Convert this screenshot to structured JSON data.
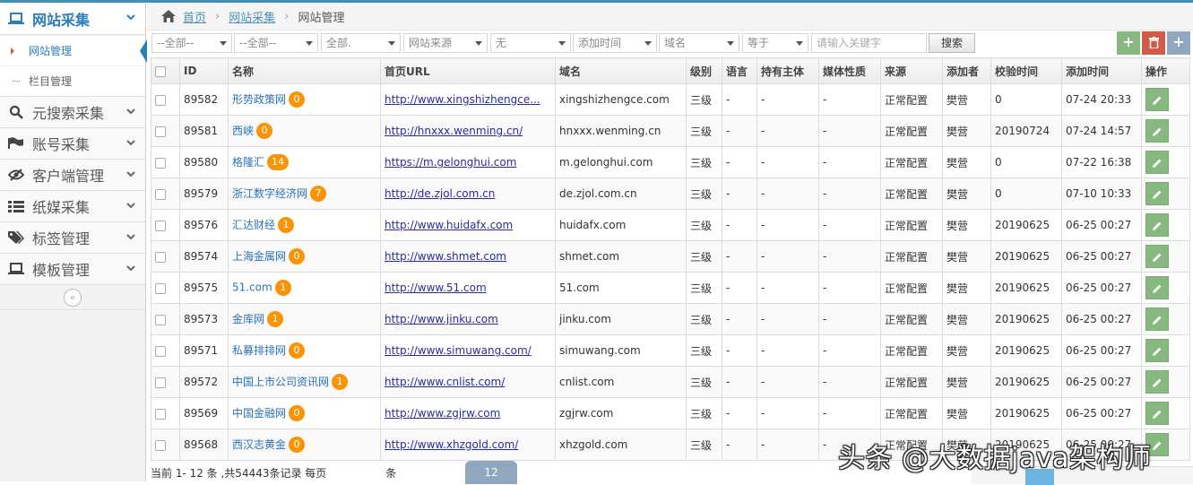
{
  "sidebar": {
    "main_item": "网站采集",
    "sub_items": [
      "网站管理",
      "栏目管理"
    ],
    "items": [
      {
        "label": "元搜索采集",
        "icon": "search-icon"
      },
      {
        "label": "账号采集",
        "icon": "flag-icon"
      },
      {
        "label": "客户端管理",
        "icon": "eye-slash-icon"
      },
      {
        "label": "纸媒采集",
        "icon": "list-icon"
      },
      {
        "label": "标签管理",
        "icon": "tags-icon"
      },
      {
        "label": "模板管理",
        "icon": "laptop-icon"
      }
    ],
    "collapse": "«"
  },
  "breadcrumb": {
    "home": "首页",
    "section": "网站采集",
    "current": "网站管理"
  },
  "filters": {
    "f1": "--全部--",
    "f2": "--全部--",
    "f3": "全部.",
    "f4": "网站来源",
    "f5": "无",
    "f6": "添加时间",
    "f7": "域名",
    "f8": "等于",
    "keyword_placeholder": "请输入关键字",
    "search": "搜索"
  },
  "actions": {
    "add": "+",
    "delete": "🗑",
    "more": "+"
  },
  "table": {
    "headers": [
      "ID",
      "名称",
      "首页URL",
      "域名",
      "级别",
      "语言",
      "持有主体",
      "媒体性质",
      "来源",
      "添加者",
      "校验时间",
      "添加时间",
      "操作"
    ],
    "rows": [
      {
        "id": "89582",
        "name": "形势政策网",
        "count": "0",
        "url": "http://www.xingshizhengce...",
        "domain": "xingshizhengce.com",
        "level": "三级",
        "lang": "-",
        "owner": "-",
        "media": "-",
        "source": "正常配置",
        "adder": "樊营",
        "check": "0",
        "added": "07-24 20:33"
      },
      {
        "id": "89581",
        "name": "西峡",
        "count": "0",
        "url": "http://hnxxx.wenming.cn/",
        "domain": "hnxxx.wenming.cn",
        "level": "三级",
        "lang": "-",
        "owner": "-",
        "media": "-",
        "source": "正常配置",
        "adder": "樊营",
        "check": "20190724",
        "added": "07-24 14:57"
      },
      {
        "id": "89580",
        "name": "格隆汇",
        "count": "14",
        "url": "https://m.gelonghui.com",
        "domain": "m.gelonghui.com",
        "level": "三级",
        "lang": "-",
        "owner": "-",
        "media": "-",
        "source": "正常配置",
        "adder": "樊营",
        "check": "0",
        "added": "07-22 16:38"
      },
      {
        "id": "89579",
        "name": "浙江数字经济网",
        "count": "7",
        "url": "http://de.zjol.com.cn",
        "domain": "de.zjol.com.cn",
        "level": "三级",
        "lang": "-",
        "owner": "-",
        "media": "-",
        "source": "正常配置",
        "adder": "樊营",
        "check": "0",
        "added": "07-10 10:33"
      },
      {
        "id": "89576",
        "name": "汇达财经",
        "count": "1",
        "url": "http://www.huidafx.com",
        "domain": "huidafx.com",
        "level": "三级",
        "lang": "-",
        "owner": "-",
        "media": "-",
        "source": "正常配置",
        "adder": "樊营",
        "check": "20190625",
        "added": "06-25 00:27"
      },
      {
        "id": "89574",
        "name": "上海金属网",
        "count": "0",
        "url": "http://www.shmet.com",
        "domain": "shmet.com",
        "level": "三级",
        "lang": "-",
        "owner": "-",
        "media": "-",
        "source": "正常配置",
        "adder": "樊营",
        "check": "20190625",
        "added": "06-25 00:27"
      },
      {
        "id": "89575",
        "name": "51.com",
        "count": "1",
        "url": "http://www.51.com",
        "domain": "51.com",
        "level": "三级",
        "lang": "-",
        "owner": "-",
        "media": "-",
        "source": "正常配置",
        "adder": "樊营",
        "check": "20190625",
        "added": "06-25 00:27"
      },
      {
        "id": "89573",
        "name": "金库网",
        "count": "1",
        "url": "http://www.jinku.com",
        "domain": "jinku.com",
        "level": "三级",
        "lang": "-",
        "owner": "-",
        "media": "-",
        "source": "正常配置",
        "adder": "樊营",
        "check": "20190625",
        "added": "06-25 00:27"
      },
      {
        "id": "89571",
        "name": "私募排排网",
        "count": "0",
        "url": "http://www.simuwang.com/",
        "domain": "simuwang.com",
        "level": "三级",
        "lang": "-",
        "owner": "-",
        "media": "-",
        "source": "正常配置",
        "adder": "樊营",
        "check": "20190625",
        "added": "06-25 00:27"
      },
      {
        "id": "89572",
        "name": "中国上市公司资讯网",
        "count": "1",
        "url": "http://www.cnlist.com/",
        "domain": "cnlist.com",
        "level": "三级",
        "lang": "-",
        "owner": "-",
        "media": "-",
        "source": "正常配置",
        "adder": "樊营",
        "check": "20190625",
        "added": "06-25 00:27"
      },
      {
        "id": "89569",
        "name": "中国金融网",
        "count": "0",
        "url": "http://www.zgjrw.com",
        "domain": "zgjrw.com",
        "level": "三级",
        "lang": "-",
        "owner": "-",
        "media": "-",
        "source": "正常配置",
        "adder": "樊营",
        "check": "20190625",
        "added": "06-25 00:27"
      },
      {
        "id": "89568",
        "name": "西汉志黄金",
        "count": "0",
        "url": "http://www.xhzgold.com/",
        "domain": "xhzgold.com",
        "level": "三级",
        "lang": "-",
        "owner": "-",
        "media": "-",
        "source": "正常配置",
        "adder": "樊营",
        "check": "20190625",
        "added": "06-25 00:27"
      }
    ]
  },
  "pager": {
    "info": "当前 1- 12 条 ,共54443条记录 每页",
    "size": "12",
    "unit": "条"
  },
  "watermark": "头条 @大数据java架构师",
  "colors": {
    "accent": "#2b7dbc",
    "badge": "#f89406",
    "edit": "#87b87f",
    "add": "#87b87f",
    "delete": "#d15b47",
    "more": "#8fa7bf"
  }
}
